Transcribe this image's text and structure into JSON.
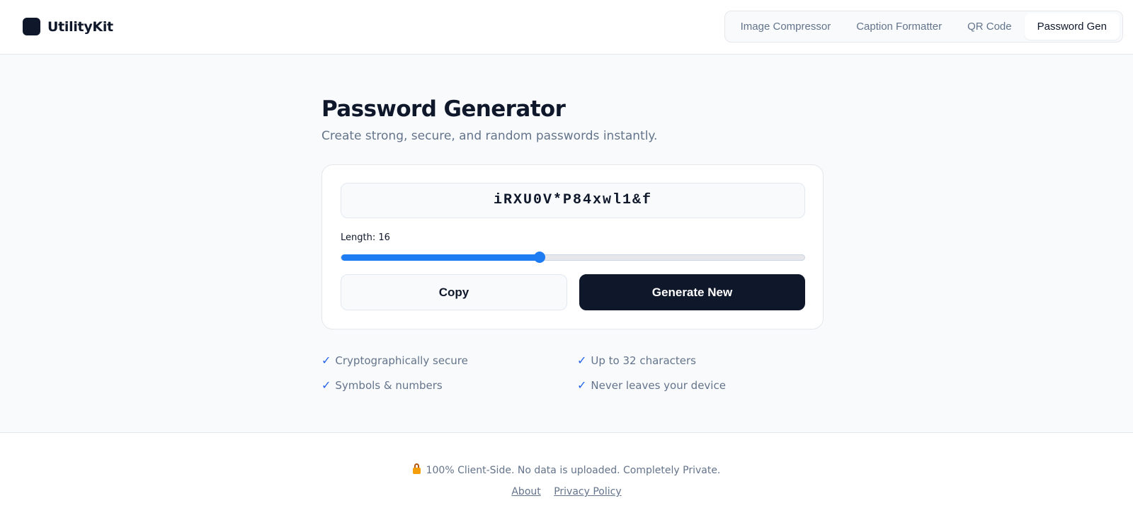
{
  "app": {
    "name": "UtilityKit",
    "logo_icon": "square-logo-icon"
  },
  "nav": {
    "items": [
      {
        "label": "Image Compressor",
        "active": false
      },
      {
        "label": "Caption Formatter",
        "active": false
      },
      {
        "label": "QR Code",
        "active": false
      },
      {
        "label": "Password Gen",
        "active": true
      }
    ]
  },
  "main": {
    "title": "Password Generator",
    "subtitle": "Create strong, secure, and random passwords instantly."
  },
  "generator": {
    "password": "iRXU0V*P84xwl1&f",
    "length_label": "Length: 16",
    "length_value": 16,
    "length_min": 4,
    "length_max": 32,
    "copy_label": "Copy",
    "generate_label": "Generate New"
  },
  "features": [
    "Cryptographically secure",
    "Up to 32 characters",
    "Symbols & numbers",
    "Never leaves your device"
  ],
  "footer": {
    "note": "100% Client-Side. No data is uploaded. Completely Private.",
    "note_icon": "lock-icon",
    "links": [
      "About",
      "Privacy Policy"
    ]
  },
  "colors": {
    "accent": "#1d7cf2",
    "primary_dark": "#0f172a",
    "check": "#2563eb",
    "muted_text": "#64748b"
  }
}
